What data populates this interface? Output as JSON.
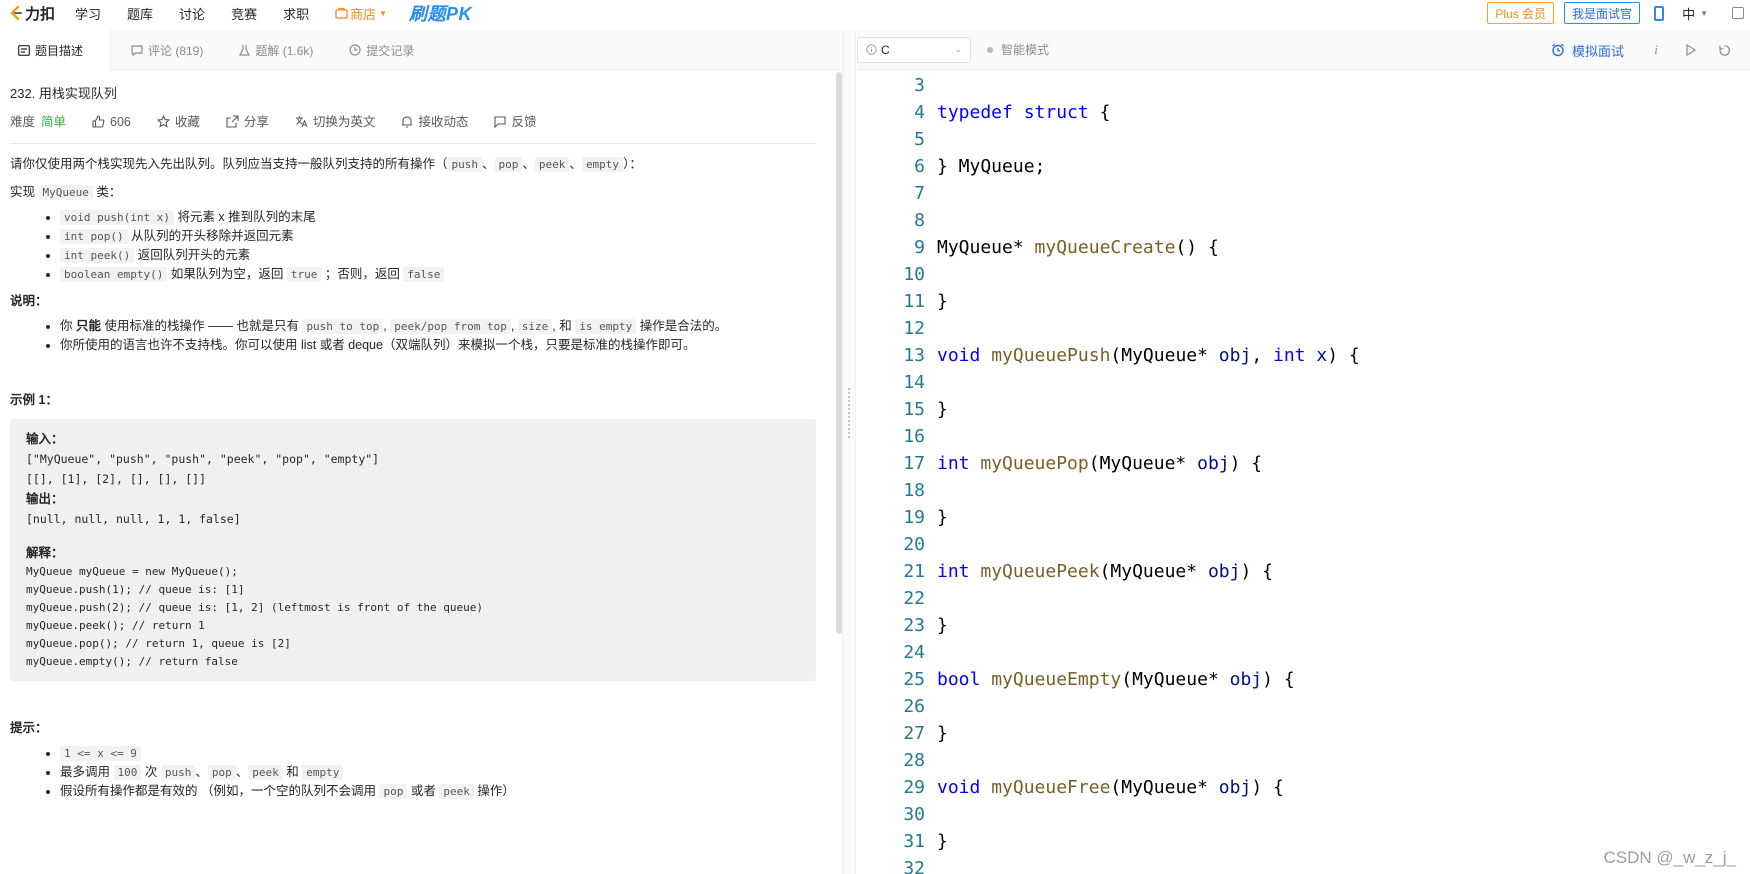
{
  "topnav": {
    "logo": "力扣",
    "items": [
      "学习",
      "题库",
      "讨论",
      "竞赛",
      "求职"
    ],
    "store": "商店",
    "pk": "刷题PK",
    "plus_button": "Plus 会员",
    "interviewer_button": "我是面试官",
    "language": "中"
  },
  "tabs": [
    {
      "label": "题目描述"
    },
    {
      "label": "评论 (819)"
    },
    {
      "label": "题解 (1.6k)"
    },
    {
      "label": "提交记录"
    }
  ],
  "problem": {
    "title": "232. 用栈实现队列",
    "difficulty_label": "难度",
    "difficulty": "简单",
    "likes": "606",
    "favorite": "收藏",
    "share": "分享",
    "switch_lang": "切换为英文",
    "subscribe": "接收动态",
    "feedback": "反馈",
    "desc_prefix": "请你仅使用两个栈实现先入先出队列。队列应当支持一般队列支持的所有操作（",
    "desc_ops": [
      "push",
      "pop",
      "peek",
      "empty"
    ],
    "desc_suffix": "）：",
    "impl_prefix": "实现",
    "impl_class": "MyQueue",
    "impl_suffix": "类：",
    "methods": [
      {
        "code": "void push(int x)",
        "text": "将元素 x 推到队列的末尾"
      },
      {
        "code": "int pop()",
        "text": "从队列的开头移除并返回元素"
      },
      {
        "code": "int peek()",
        "text": "返回队列开头的元素"
      },
      {
        "code": "boolean empty()",
        "text": "如果队列为空，返回",
        "code2": "true",
        "text2": "；否则，返回",
        "code3": "false"
      }
    ],
    "note_title": "说明：",
    "note1_a": "你",
    "note1_bold": "只能",
    "note1_b": "使用标准的栈操作 —— 也就是只有",
    "note1_c1": "push to top",
    "note1_c2": "peek/pop from top",
    "note1_c3": "size",
    "note1_and": "和",
    "note1_c4": "is empty",
    "note1_end": "操作是合法的。",
    "note2": "你所使用的语言也许不支持栈。你可以使用 list 或者 deque（双端队列）来模拟一个栈，只要是标准的栈操作即可。",
    "example_title": "示例 1：",
    "example": {
      "input_label": "输入：",
      "input1": "[\"MyQueue\", \"push\", \"push\", \"peek\", \"pop\", \"empty\"]",
      "input2": "[[], [1], [2], [], [], []]",
      "output_label": "输出：",
      "output": "[null, null, null, 1, 1, false]",
      "explain_label": "解释：",
      "explain": [
        "MyQueue myQueue = new MyQueue();",
        "myQueue.push(1); // queue is: [1]",
        "myQueue.push(2); // queue is: [1, 2] (leftmost is front of the queue)",
        "myQueue.peek(); // return 1",
        "myQueue.pop(); // return 1, queue is [2]",
        "myQueue.empty(); // return false"
      ]
    },
    "hint_title": "提示：",
    "hint1": "1 <= x <= 9",
    "hint2_a": "最多调用",
    "hint2_c1": "100",
    "hint2_b": "次",
    "hint2_c2": "push",
    "hint2_c3": "pop",
    "hint2_c4": "peek",
    "hint2_and": "和",
    "hint2_c5": "empty",
    "hint3_a": "假设所有操作都是有效的 （例如，一个空的队列不会调用",
    "hint3_c1": "pop",
    "hint3_or": "或者",
    "hint3_c2": "peek",
    "hint3_end": "操作）"
  },
  "editor_toolbar": {
    "language": "C",
    "smart_mode": "智能模式",
    "mock_interview": "模拟面试"
  },
  "code_lines": [
    {
      "n": "3"
    },
    {
      "n": "4"
    },
    {
      "n": "5"
    },
    {
      "n": "6"
    },
    {
      "n": "7"
    },
    {
      "n": "8"
    },
    {
      "n": "9"
    },
    {
      "n": "10"
    },
    {
      "n": "11"
    },
    {
      "n": "12"
    },
    {
      "n": "13"
    },
    {
      "n": "14"
    },
    {
      "n": "15"
    },
    {
      "n": "16"
    },
    {
      "n": "17"
    },
    {
      "n": "18"
    },
    {
      "n": "19"
    },
    {
      "n": "20"
    },
    {
      "n": "21"
    },
    {
      "n": "22"
    },
    {
      "n": "23"
    },
    {
      "n": "24"
    },
    {
      "n": "25"
    },
    {
      "n": "26"
    },
    {
      "n": "27"
    },
    {
      "n": "28"
    },
    {
      "n": "29"
    },
    {
      "n": "30"
    },
    {
      "n": "31"
    },
    {
      "n": "32"
    }
  ],
  "code": {
    "l4_kw1": "typedef",
    "l4_kw2": "struct",
    "l4_rest": " {",
    "l6": "} MyQueue;",
    "l9_type": "MyQueue*",
    "l9_fn": "myQueueCreate",
    "l9_rest": "() {",
    "brace": "}",
    "l13_kw": "void",
    "l13_fn": "myQueuePush",
    "l13_a": "(MyQueue* ",
    "l13_obj": "obj",
    "l13_b": ", ",
    "l13_int": "int",
    "l13_x": "x",
    "l13_c": ") {",
    "l17_kw": "int",
    "l17_fn": "myQueuePop",
    "l17_a": "(MyQueue* ",
    "l17_obj": "obj",
    "l17_c": ") {",
    "l21_kw": "int",
    "l21_fn": "myQueuePeek",
    "l21_a": "(MyQueue* ",
    "l21_obj": "obj",
    "l21_c": ") {",
    "l25_kw": "bool",
    "l25_fn": "myQueueEmpty",
    "l25_a": "(MyQueue* ",
    "l25_obj": "obj",
    "l25_c": ") {",
    "l29_kw": "void",
    "l29_fn": "myQueueFree",
    "l29_a": "(MyQueue* ",
    "l29_obj": "obj",
    "l29_c": ") {"
  },
  "watermark": "CSDN @_w_z_j_"
}
